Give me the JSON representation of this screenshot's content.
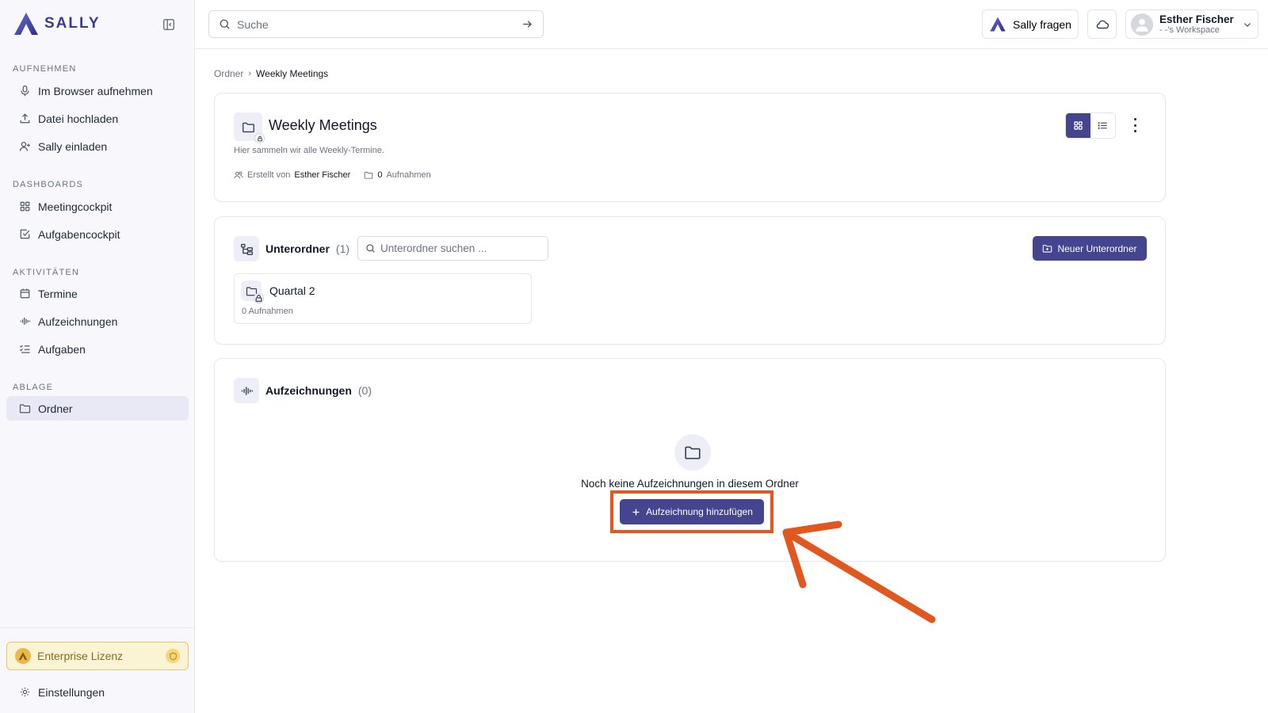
{
  "app": {
    "logo_text": "SALLY"
  },
  "sidebar": {
    "sections": [
      {
        "label": "AUFNEHMEN"
      },
      {
        "label": "DASHBOARDS"
      },
      {
        "label": "AKTIVITÄTEN"
      },
      {
        "label": "ABLAGE"
      }
    ],
    "items": [
      {
        "label": "Im Browser aufnehmen",
        "icon": "mic-icon"
      },
      {
        "label": "Datei hochladen",
        "icon": "upload-icon"
      },
      {
        "label": "Sally einladen",
        "icon": "user-plus-icon"
      },
      {
        "label": "Meetingcockpit",
        "icon": "grid-icon"
      },
      {
        "label": "Aufgabencockpit",
        "icon": "checkbox-icon"
      },
      {
        "label": "Termine",
        "icon": "calendar-icon"
      },
      {
        "label": "Aufzeichnungen",
        "icon": "waveform-icon"
      },
      {
        "label": "Aufgaben",
        "icon": "list-check-icon"
      },
      {
        "label": "Ordner",
        "icon": "folder-icon"
      }
    ],
    "license_label": "Enterprise Lizenz",
    "settings_label": "Einstellungen"
  },
  "topbar": {
    "search_placeholder": "Suche",
    "ask_label": "Sally fragen",
    "user_name": "Esther Fischer",
    "user_workspace": "- -'s Workspace"
  },
  "breadcrumb": {
    "parent": "Ordner",
    "current": "Weekly Meetings"
  },
  "folder": {
    "title": "Weekly Meetings",
    "description": "Hier sammeln wir alle Weekly-Termine.",
    "created_by_label": "Erstellt von",
    "created_by": "Esther Fischer",
    "recordings_count": "0",
    "recordings_label": "Aufnahmen"
  },
  "subfolders": {
    "title": "Unterordner",
    "count": "(1)",
    "search_placeholder": "Unterordner suchen ...",
    "new_button": "Neuer Unterordner",
    "items": [
      {
        "name": "Quartal 2",
        "count": "0 Aufnahmen"
      }
    ]
  },
  "recordings": {
    "title": "Aufzeichnungen",
    "count": "(0)",
    "empty_text": "Noch keine Aufzeichnungen in diesem Ordner",
    "add_button": "Aufzeichnung hinzufügen"
  },
  "colors": {
    "accent": "#45458f",
    "highlight": "#e2571e",
    "license_bg": "#fbf3d5"
  }
}
